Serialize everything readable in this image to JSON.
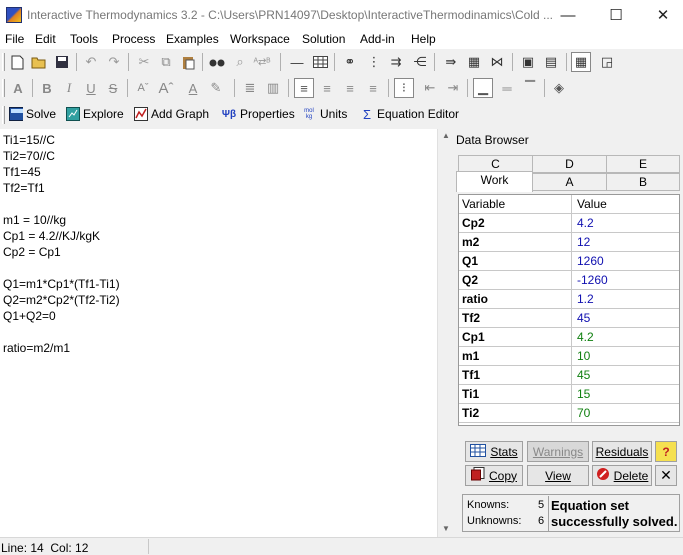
{
  "window": {
    "title": "Interactive Thermodynamics 3.2 - C:\\Users\\PRN14097\\Desktop\\InteractiveThermodinamics\\Cold ...",
    "minimize": "—",
    "maximize": "☐",
    "close": "✕"
  },
  "menu": [
    "File",
    "Edit",
    "Tools",
    "Process",
    "Examples",
    "Workspace",
    "Solution",
    "Add-in",
    "Help"
  ],
  "commands": {
    "solve": "Solve",
    "explore": "Explore",
    "add_graph": "Add Graph",
    "properties": "Properties",
    "units_icon": "mol kg",
    "units": "Units",
    "equation_editor": "Equation Editor"
  },
  "editor": {
    "lines": [
      "Ti1=15//C",
      "Ti2=70//C",
      "Tf1=45",
      "Tf2=Tf1",
      "",
      "m1 = 10//kg",
      "Cp1 = 4.2//KJ/kgK",
      "Cp2 = Cp1",
      "",
      "Q1=m1*Cp1*(Tf1-Ti1)",
      "Q2=m2*Cp2*(Tf2-Ti2)",
      "Q1+Q2=0",
      "",
      "ratio=m2/m1"
    ]
  },
  "data_browser": {
    "title": "Data Browser",
    "tabs_top": [
      "C",
      "D",
      "E"
    ],
    "tabs_bottom": [
      "Work",
      "A",
      "B"
    ],
    "active_tab": "Work",
    "col_variable": "Variable",
    "col_value": "Value",
    "rows": [
      {
        "variable": "Cp2",
        "value": "4.2",
        "kind": "computed"
      },
      {
        "variable": "m2",
        "value": "12",
        "kind": "computed"
      },
      {
        "variable": "Q1",
        "value": "1260",
        "kind": "computed"
      },
      {
        "variable": "Q2",
        "value": "-1260",
        "kind": "computed"
      },
      {
        "variable": "ratio",
        "value": "1.2",
        "kind": "computed"
      },
      {
        "variable": "Tf2",
        "value": "45",
        "kind": "computed"
      },
      {
        "variable": "Cp1",
        "value": "4.2",
        "kind": "known"
      },
      {
        "variable": "m1",
        "value": "10",
        "kind": "known"
      },
      {
        "variable": "Tf1",
        "value": "45",
        "kind": "known"
      },
      {
        "variable": "Ti1",
        "value": "15",
        "kind": "known"
      },
      {
        "variable": "Ti2",
        "value": "70",
        "kind": "known"
      }
    ],
    "buttons": {
      "stats": "Stats",
      "warnings": "Warnings",
      "residuals": "Residuals",
      "help": "?",
      "copy": "Copy",
      "view": "View",
      "delete": "Delete",
      "close": "✕"
    },
    "knowns_label": "Knowns:",
    "knowns_value": "5",
    "unknowns_label": "Unknowns:",
    "unknowns_value": "6",
    "status_message_1": "Equation set",
    "status_message_2": "successfully solved."
  },
  "statusbar": {
    "position": "Line: 14  Col: 12"
  },
  "colors": {
    "computed": "#1010b0",
    "known": "#108010"
  }
}
